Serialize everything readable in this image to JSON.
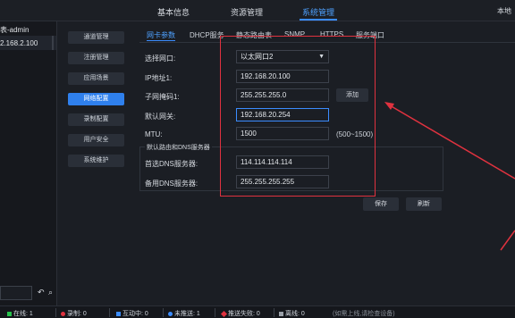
{
  "topbar": {
    "nav": [
      "基本信息",
      "资源管理",
      "系统管理"
    ],
    "right_text": "本地"
  },
  "leftpanel": {
    "line1": "表-admin",
    "line2": "2.168.2.100",
    "search_placeholder": "",
    "refresh_glyph": "↶",
    "search_glyph": "⌕"
  },
  "sidemenu": [
    "通道管理",
    "注册管理",
    "应用场景",
    "网络配置",
    "录制配置",
    "用户安全",
    "系统维护"
  ],
  "tabs": [
    "网卡参数",
    "DHCP服务",
    "静态路由表",
    "SNMP",
    "HTTPS",
    "服务端口"
  ],
  "form": {
    "port_label": "选择网口:",
    "port_value": "以太网口2",
    "ip_label": "IP地址1:",
    "ip_value": "192.168.20.100",
    "mask_label": "子网掩码1:",
    "mask_value": "255.255.255.0",
    "add_label": "添加",
    "gateway_label": "默认网关:",
    "gateway_value": "192.168.20.254",
    "mtu_label": "MTU:",
    "mtu_value": "1500",
    "mtu_hint": "(500~1500)",
    "dns_group_title": "默认路由和DNS服务器",
    "dns1_label": "首选DNS服务器:",
    "dns1_value": "114.114.114.114",
    "dns2_label": "备用DNS服务器:",
    "dns2_value": "255.255.255.255",
    "save_label": "保存",
    "refresh_label": "刷新"
  },
  "statusbar": {
    "online": "在线: 1",
    "recording": "录制: 0",
    "interacting": "互动中: 0",
    "not_pushed": "未推送: 1",
    "push_failed": "推送失败: 0",
    "offline": "离线: 0",
    "hint": "(如需上线,请检查设备)"
  },
  "colors": {
    "accent": "#2f80ed",
    "annotation": "#e0323f",
    "online": "#27c24c",
    "recording": "#e0323f",
    "interacting": "#3b8cff",
    "not_pushed": "#3b8cff",
    "push_failed": "#e0323f",
    "offline": "#9aa0a8"
  }
}
